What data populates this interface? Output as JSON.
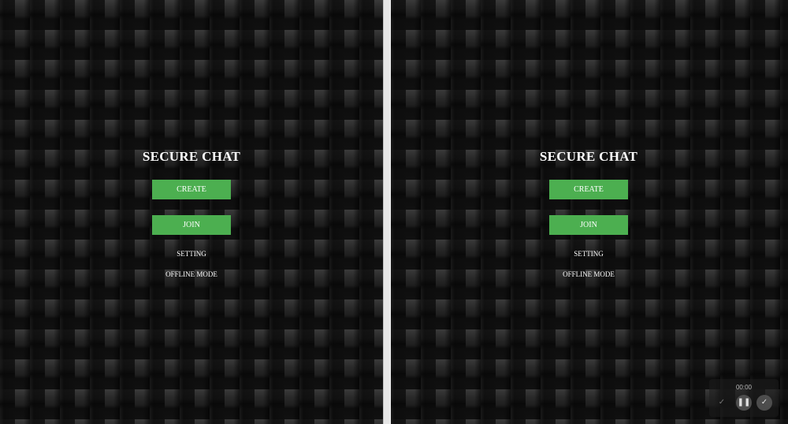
{
  "left_pane": {
    "title": "SECURE CHAT",
    "create_label": "CREATE",
    "join_label": "JOIN",
    "setting_label": "SETTING",
    "offline_label": "OFFLINE MODE"
  },
  "right_pane": {
    "title": "SECURE CHAT",
    "create_label": "CREATE",
    "join_label": "JOIN",
    "setting_label": "SETTING",
    "offline_label": "OFFLINE MODE"
  },
  "recorder": {
    "time": "00:00",
    "back_icon": "✓",
    "pause_icon": "❚❚",
    "done_icon": "✓"
  },
  "colors": {
    "accent": "#4caf50",
    "background": "#1c1c1c",
    "divider": "#e6e6e6",
    "text": "#ffffff"
  }
}
